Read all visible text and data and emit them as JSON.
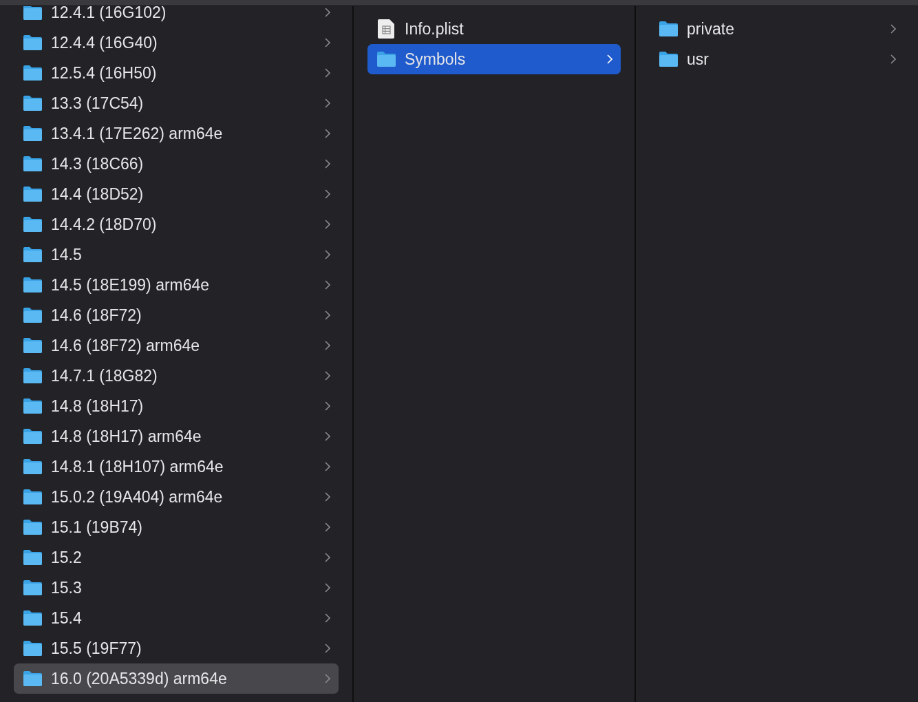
{
  "columns": [
    {
      "active": false,
      "items": [
        {
          "kind": "folder",
          "name": "12.4.1 (16G102)",
          "selected": false
        },
        {
          "kind": "folder",
          "name": "12.4.4 (16G40)",
          "selected": false
        },
        {
          "kind": "folder",
          "name": "12.5.4 (16H50)",
          "selected": false
        },
        {
          "kind": "folder",
          "name": "13.3 (17C54)",
          "selected": false
        },
        {
          "kind": "folder",
          "name": "13.4.1 (17E262) arm64e",
          "selected": false
        },
        {
          "kind": "folder",
          "name": "14.3 (18C66)",
          "selected": false
        },
        {
          "kind": "folder",
          "name": "14.4 (18D52)",
          "selected": false
        },
        {
          "kind": "folder",
          "name": "14.4.2 (18D70)",
          "selected": false
        },
        {
          "kind": "folder",
          "name": "14.5",
          "selected": false
        },
        {
          "kind": "folder",
          "name": "14.5 (18E199) arm64e",
          "selected": false
        },
        {
          "kind": "folder",
          "name": "14.6 (18F72)",
          "selected": false
        },
        {
          "kind": "folder",
          "name": "14.6 (18F72) arm64e",
          "selected": false
        },
        {
          "kind": "folder",
          "name": "14.7.1 (18G82)",
          "selected": false
        },
        {
          "kind": "folder",
          "name": "14.8 (18H17)",
          "selected": false
        },
        {
          "kind": "folder",
          "name": "14.8 (18H17) arm64e",
          "selected": false
        },
        {
          "kind": "folder",
          "name": "14.8.1 (18H107) arm64e",
          "selected": false
        },
        {
          "kind": "folder",
          "name": "15.0.2 (19A404) arm64e",
          "selected": false
        },
        {
          "kind": "folder",
          "name": "15.1 (19B74)",
          "selected": false
        },
        {
          "kind": "folder",
          "name": "15.2",
          "selected": false
        },
        {
          "kind": "folder",
          "name": "15.3",
          "selected": false
        },
        {
          "kind": "folder",
          "name": "15.4",
          "selected": false
        },
        {
          "kind": "folder",
          "name": "15.5 (19F77)",
          "selected": false
        },
        {
          "kind": "folder",
          "name": "16.0 (20A5339d) arm64e",
          "selected": true
        }
      ]
    },
    {
      "active": true,
      "items": [
        {
          "kind": "file",
          "name": "Info.plist",
          "selected": false
        },
        {
          "kind": "folder",
          "name": "Symbols",
          "selected": true
        }
      ]
    },
    {
      "items": [
        {
          "kind": "folder",
          "name": "private",
          "selected": false
        },
        {
          "kind": "folder",
          "name": "usr",
          "selected": false
        }
      ]
    }
  ]
}
